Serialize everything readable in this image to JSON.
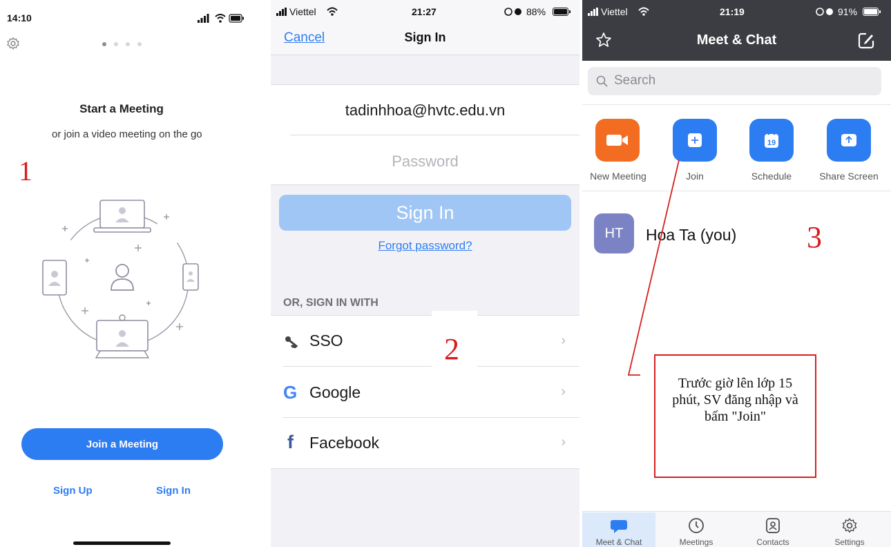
{
  "panel1": {
    "status_time": "14:10",
    "title": "Start a Meeting",
    "subtitle": "or join a video meeting on the go",
    "join_button": "Join a Meeting",
    "sign_up": "Sign Up",
    "sign_in": "Sign In",
    "step_number": "1",
    "icons": [
      "gear-icon",
      "signal-icon",
      "wifi-icon",
      "battery-icon"
    ]
  },
  "panel2": {
    "status_carrier": "Viettel",
    "status_time": "21:27",
    "status_battery": "88%",
    "cancel": "Cancel",
    "nav_title": "Sign In",
    "email_value": "tadinhhoa@hvtc.edu.vn",
    "password_placeholder": "Password",
    "sign_in_button": "Sign In",
    "forgot_password": "Forgot password?",
    "section_header": "OR, SIGN IN WITH",
    "options": [
      {
        "label": "SSO",
        "icon": "key-icon"
      },
      {
        "label": "Google",
        "icon": "google-icon"
      },
      {
        "label": "Facebook",
        "icon": "facebook-icon"
      }
    ],
    "step_number": "2"
  },
  "panel3": {
    "status_carrier": "Viettel",
    "status_time": "21:19",
    "status_battery": "91%",
    "header_title": "Meet & Chat",
    "search_placeholder": "Search",
    "actions": [
      {
        "label": "New Meeting",
        "icon": "video-camera-icon",
        "color": "#f26d21"
      },
      {
        "label": "Join",
        "icon": "plus-icon",
        "color": "#2d7df2"
      },
      {
        "label": "Schedule",
        "icon": "calendar-icon",
        "color": "#2d7df2",
        "day": "19"
      },
      {
        "label": "Share Screen",
        "icon": "share-screen-icon",
        "color": "#2d7df2"
      }
    ],
    "contact_initials": "HT",
    "contact_name": "Hoa Ta (you)",
    "step_number": "3",
    "annotation": "Trước giờ lên lớp 15 phút, SV đăng nhập và bấm \"Join\"",
    "tabs": [
      {
        "label": "Meet & Chat",
        "icon": "chat-icon",
        "active": true
      },
      {
        "label": "Meetings",
        "icon": "clock-icon",
        "active": false
      },
      {
        "label": "Contacts",
        "icon": "contacts-icon",
        "active": false
      },
      {
        "label": "Settings",
        "icon": "gear-icon",
        "active": false
      }
    ]
  },
  "colors": {
    "accent": "#2d7df2",
    "annotation_red": "#d71e1e",
    "header_dark": "#3b3d42",
    "orange": "#f26d21",
    "avatar": "#7b83c4"
  }
}
